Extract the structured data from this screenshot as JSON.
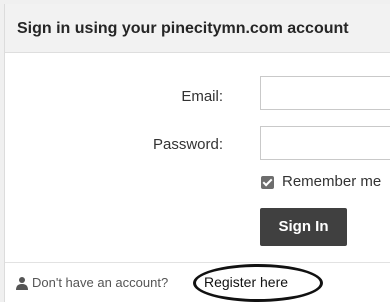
{
  "header": {
    "title": "Sign in using your pinecitymn.com account"
  },
  "form": {
    "email_label": "Email:",
    "email_value": "",
    "password_label": "Password:",
    "password_value": "",
    "remember_label": "Remember me",
    "remember_checked": true,
    "submit_label": "Sign In"
  },
  "footer": {
    "prompt": "Don't have an account?",
    "register_label": "Register here"
  },
  "icons": {
    "user": "user-icon"
  }
}
